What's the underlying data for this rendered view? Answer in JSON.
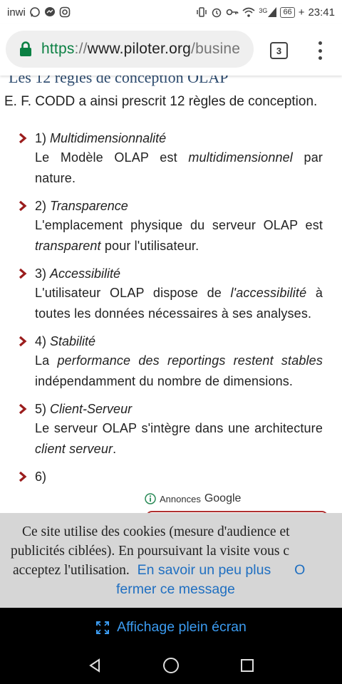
{
  "status_bar": {
    "carrier": "inwi",
    "battery": "66",
    "time": "23:41",
    "signal_label": "3G"
  },
  "browser": {
    "url_scheme": "https",
    "url_sep": "://",
    "url_host": "www.piloter.org",
    "url_path": "/busine",
    "tab_count": "3"
  },
  "page": {
    "heading": "Les 12 règles de conception OLAP",
    "intro": "E. F. CODD a ainsi prescrit 12 règles de conception.",
    "rules": [
      {
        "num": "1)",
        "title": "Multidimensionnalité",
        "desc_parts": [
          "Le Modèle OLAP est ",
          "multidimensionnel",
          " par nature."
        ]
      },
      {
        "num": "2)",
        "title": "Transparence",
        "desc_parts": [
          "L'emplacement physique du serveur OLAP est ",
          "transparent",
          " pour l'utilisateur."
        ]
      },
      {
        "num": "3)",
        "title": "Accessibilité",
        "desc_parts": [
          "L'utilisateur OLAP dispose de ",
          "l'accessibilité",
          " à toutes les données nécessaires à ses analyses."
        ]
      },
      {
        "num": "4)",
        "title": "Stabilité",
        "desc_parts": [
          "La ",
          "performance des reportings restent stables",
          " indépendamment du nombre de dimensions."
        ]
      },
      {
        "num": "5)",
        "title": "Client-Serveur",
        "desc_parts": [
          "Le serveur OLAP s'intègre dans une architecture ",
          "client serveur",
          "."
        ]
      },
      {
        "num": "6)",
        "title": "",
        "desc_parts": [
          "",
          "",
          ""
        ]
      }
    ],
    "ads_label": "Annonces",
    "ads_brand": "Google"
  },
  "cookie_banner": {
    "line1": "Ce site utilise des cookies (mesure d'audience et",
    "line2": "publicités ciblées). En poursuivant la visite vous c",
    "line3": "acceptez l'utilisation.",
    "more_link": "En savoir un peu plus",
    "or_text": "O",
    "close_link": "fermer ce message"
  },
  "fullscreen": {
    "label": "Affichage plein écran"
  },
  "colors": {
    "url_green": "#0b8043",
    "link_blue": "#1f6fc1",
    "bullet_red": "#9b1d1d",
    "heading_blue": "#2c4a6e"
  },
  "icons": [
    "whatsapp-icon",
    "messenger-icon",
    "instagram-icon",
    "vibrate-icon",
    "alarm-icon",
    "key-icon",
    "wifi-icon",
    "signal-icon",
    "battery-icon",
    "lock-icon",
    "more-vert-icon",
    "chevron-right-icon",
    "info-icon",
    "fullscreen-icon",
    "back-icon",
    "home-icon",
    "recents-icon"
  ]
}
